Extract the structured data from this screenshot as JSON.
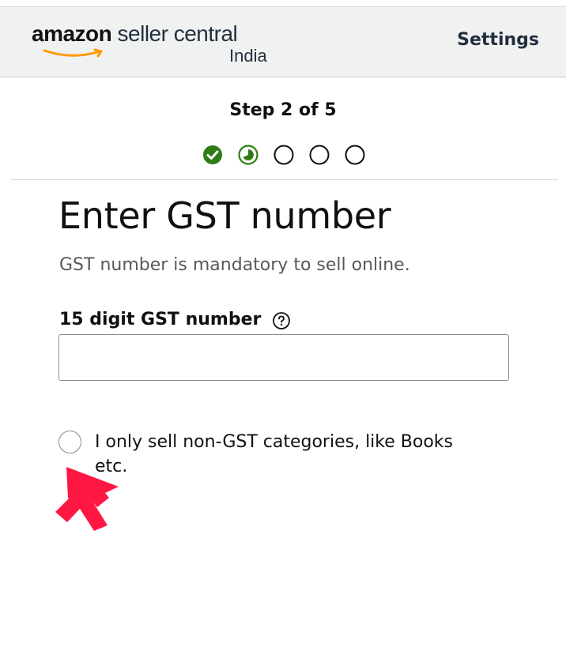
{
  "header": {
    "logo_brand": "amazon",
    "logo_product": "seller central",
    "logo_region": "India",
    "settings_label": "Settings"
  },
  "progress": {
    "label": "Step 2 of 5",
    "current_step": 2,
    "total_steps": 5,
    "steps": [
      {
        "state": "complete"
      },
      {
        "state": "in-progress"
      },
      {
        "state": "pending"
      },
      {
        "state": "pending"
      },
      {
        "state": "pending"
      }
    ]
  },
  "form": {
    "title": "Enter GST number",
    "subtitle": "GST number is mandatory to sell online.",
    "gst_label": "15 digit GST number",
    "gst_value": "",
    "gst_placeholder": "",
    "non_gst_option_label": "I only sell non-GST categories, like Books etc.",
    "non_gst_checked": false
  },
  "icons": {
    "help": "question-circle-icon",
    "step_complete": "check-circle-icon",
    "step_in_progress": "partial-circle-icon",
    "annotation_arrow": "red-arrow-icon"
  },
  "colors": {
    "step_green": "#2e7d14",
    "arrow_red": "#ff1744",
    "header_bg": "#f0f2f2",
    "logo_smile": "#ff9900"
  }
}
